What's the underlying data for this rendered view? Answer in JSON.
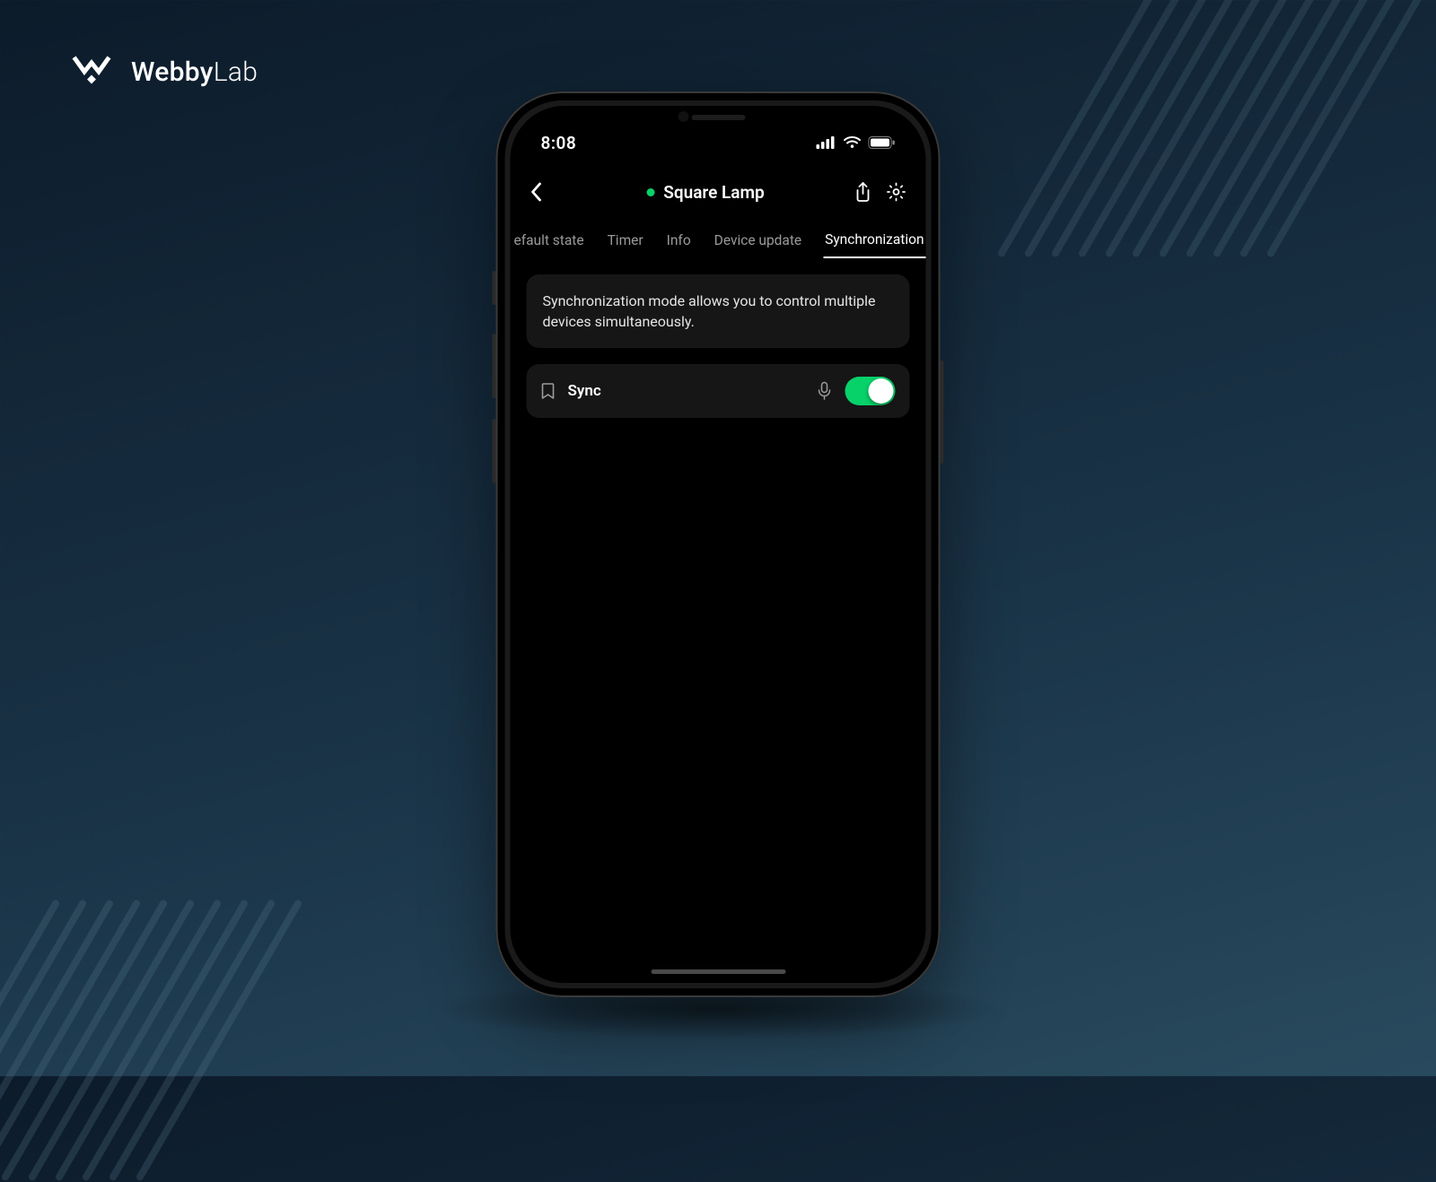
{
  "brand": {
    "name_a": "Webby",
    "name_b": "Lab"
  },
  "statusbar": {
    "time": "8:08"
  },
  "navbar": {
    "title": "Square Lamp",
    "status_color": "#07d26a"
  },
  "tabs": {
    "items": [
      {
        "label": "efault state",
        "active": false
      },
      {
        "label": "Timer",
        "active": false
      },
      {
        "label": "Info",
        "active": false
      },
      {
        "label": "Device update",
        "active": false
      },
      {
        "label": "Synchronization",
        "active": true
      }
    ]
  },
  "content": {
    "description": "Synchronization mode allows you to control multiple devices simultaneously.",
    "sync_row": {
      "label": "Sync",
      "enabled": true
    }
  },
  "colors": {
    "accent": "#07d26a",
    "card_bg": "#161616"
  }
}
